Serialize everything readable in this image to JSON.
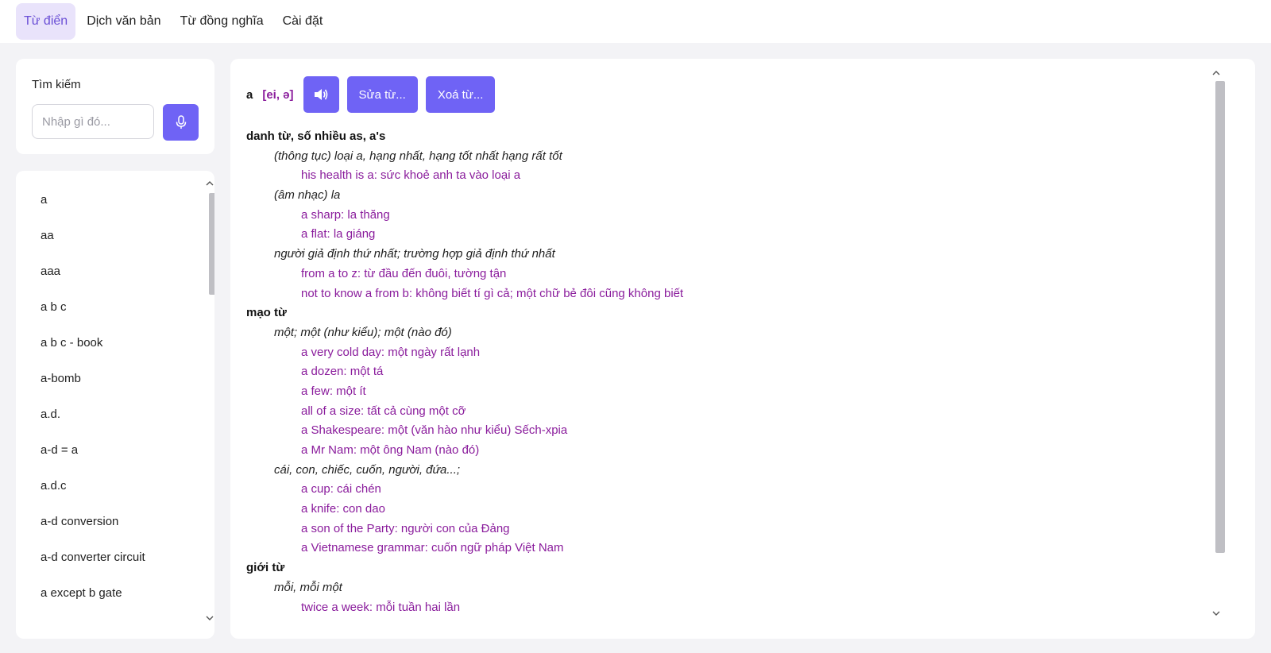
{
  "nav": {
    "tabs": [
      {
        "label": "Từ điển",
        "active": true
      },
      {
        "label": "Dịch văn bản",
        "active": false
      },
      {
        "label": "Từ đồng nghĩa",
        "active": false
      },
      {
        "label": "Cài đặt",
        "active": false
      }
    ]
  },
  "search": {
    "label": "Tìm kiếm",
    "placeholder": "Nhập gì đó...",
    "mic_icon": "microphone-icon"
  },
  "word_list": {
    "items": [
      "a",
      "aa",
      "aaa",
      "a b c",
      "a b c - book",
      "a-bomb",
      "a.d.",
      "a-d = a",
      "a.d.c",
      "a-d conversion",
      "a-d converter circuit",
      "a except b gate"
    ]
  },
  "entry": {
    "headword": "a",
    "phonetic": "[ei, ə]",
    "speak_icon": "speaker-icon",
    "edit_label": "Sửa từ...",
    "delete_label": "Xoá từ...",
    "lines": [
      {
        "type": "pos",
        "text": "danh từ,  số nhiều as,  a's"
      },
      {
        "type": "meaning",
        "text": "(thông tục) loại a, hạng nhất, hạng tốt nhất hạng rất tốt"
      },
      {
        "type": "example",
        "text": "his health is a: sức khoẻ anh ta vào loại a"
      },
      {
        "type": "meaning",
        "text": "(âm nhạc) la"
      },
      {
        "type": "example",
        "text": "a sharp: la thăng"
      },
      {
        "type": "example",
        "text": "a flat: la giáng"
      },
      {
        "type": "meaning",
        "text": "người giả định thứ nhất; trường hợp giả định thứ nhất"
      },
      {
        "type": "example",
        "text": "from a to z: từ đầu đến đuôi, tường tận"
      },
      {
        "type": "example",
        "text": "not to know a from b: không biết tí gì cả; một chữ bẻ đôi cũng không biết"
      },
      {
        "type": "pos",
        "text": "mạo từ"
      },
      {
        "type": "meaning",
        "text": "một; một (như kiểu); một (nào đó)"
      },
      {
        "type": "example",
        "text": "a very cold day: một ngày rất lạnh"
      },
      {
        "type": "example",
        "text": "a dozen: một tá"
      },
      {
        "type": "example",
        "text": "a few: một ít"
      },
      {
        "type": "example",
        "text": "all of a size: tất cả cùng một cỡ"
      },
      {
        "type": "example",
        "text": "a Shakespeare: một (văn hào như kiểu) Sếch-xpia"
      },
      {
        "type": "example",
        "text": "a Mr Nam: một ông Nam (nào đó)"
      },
      {
        "type": "meaning",
        "text": "cái, con, chiếc, cuốn, người, đứa...;"
      },
      {
        "type": "example",
        "text": "a cup: cái chén"
      },
      {
        "type": "example",
        "text": "a knife: con dao"
      },
      {
        "type": "example",
        "text": "a son of the Party: người con của Đảng"
      },
      {
        "type": "example",
        "text": "a Vietnamese grammar: cuốn ngữ pháp Việt Nam"
      },
      {
        "type": "pos",
        "text": "giới từ"
      },
      {
        "type": "meaning",
        "text": "mỗi, mỗi một"
      },
      {
        "type": "example",
        "text": "twice a week: mỗi tuần hai lần"
      }
    ]
  },
  "colors": {
    "accent": "#6f63f5",
    "example_text": "#8a1c9c",
    "active_tab_bg": "#e9e3fb"
  }
}
